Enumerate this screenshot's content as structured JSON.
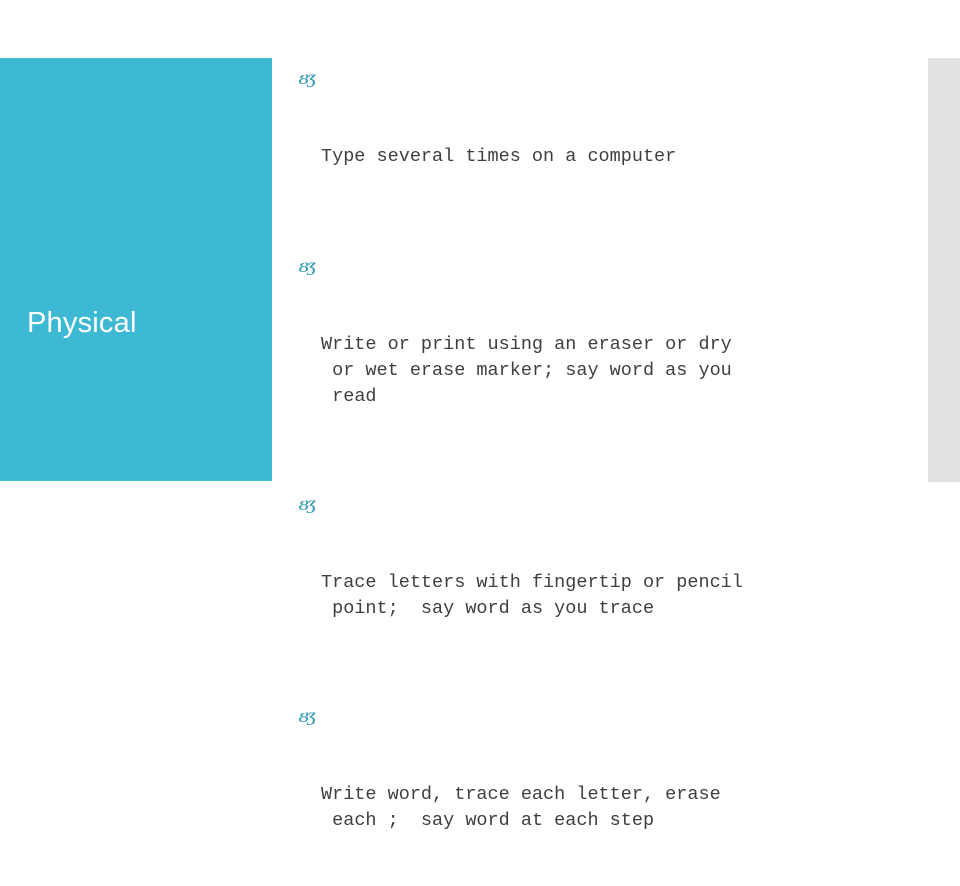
{
  "slide": {
    "title": "Physical",
    "accent_color": "#3eb9d3",
    "body_text_color": "#3f3f3f",
    "bullet_color": "#3c9fb5",
    "edge_strip_color": "#e2e2e2",
    "bullet_glyph": "ȢƷ",
    "bullets": [
      {
        "glyph": "ȢƷ",
        "text": "Type several times on a computer"
      },
      {
        "glyph": "ȢƷ",
        "text": "Write or print using an eraser or dry\n or wet erase marker; say word as you\n read"
      },
      {
        "glyph": "ȢƷ",
        "text": "Trace letters with fingertip or pencil\n point;  say word as you trace"
      },
      {
        "glyph": "ȢƷ",
        "text": "Write word, trace each letter, erase\n each ;  say word at each step"
      }
    ]
  }
}
